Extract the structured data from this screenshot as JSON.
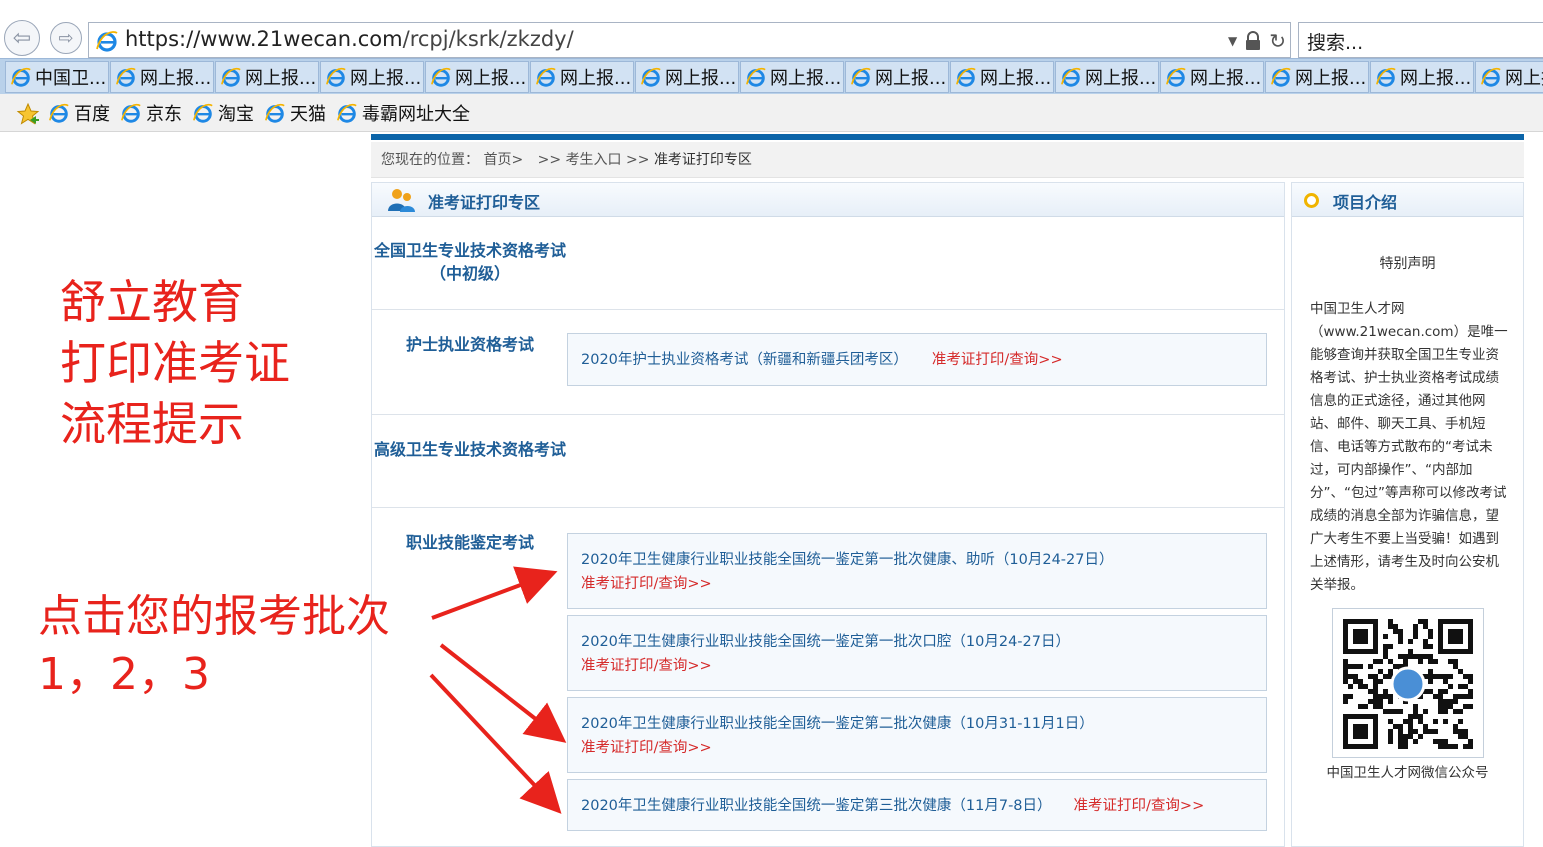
{
  "browser": {
    "url": "https://www.21wecan.com/rcpj/ksrk/zkzdy/",
    "url_host": "https://www.21wecan.com",
    "url_path": "/rcpj/ksrk/zkzdy/",
    "search_placeholder": "搜索...",
    "tabs": [
      "中国卫...",
      "网上报...",
      "网上报...",
      "网上报...",
      "网上报...",
      "网上报...",
      "网上报...",
      "网上报...",
      "网上报...",
      "网上报...",
      "网上报...",
      "网上报...",
      "网上报...",
      "网上报...",
      "网上报..."
    ],
    "favorites": [
      "百度",
      "京东",
      "淘宝",
      "天猫",
      "毒霸网址大全"
    ],
    "icons": [
      "back-arrow-icon",
      "forward-arrow-icon",
      "ie-logo-icon",
      "lock-icon",
      "refresh-icon",
      "dropdown-icon",
      "favorites-star-icon"
    ]
  },
  "breadcrumb": {
    "prefix": "您现在的位置：",
    "home": "首页>",
    "sep1": ">>",
    "level1": "考生入口",
    "sep2": ">>",
    "current": "准考证打印专区"
  },
  "main": {
    "title": "准考证打印专区",
    "sections": [
      {
        "label": "全国卫生专业技术资格考试（中初级）",
        "exams": []
      },
      {
        "label": "护士执业资格考试",
        "exams": [
          {
            "name": "2020年护士执业资格考试（新疆和新疆兵团考区）",
            "link": "准考证打印/查询>>"
          }
        ]
      },
      {
        "label": "高级卫生专业技术资格考试",
        "exams": []
      },
      {
        "label": "职业技能鉴定考试",
        "exams": [
          {
            "name": "2020年卫生健康行业职业技能全国统一鉴定第一批次健康、助听（10月24-27日）",
            "link": "准考证打印/查询>>"
          },
          {
            "name": "2020年卫生健康行业职业技能全国统一鉴定第一批次口腔（10月24-27日）",
            "link": "准考证打印/查询>>"
          },
          {
            "name": "2020年卫生健康行业职业技能全国统一鉴定第二批次健康（10月31-11月1日）",
            "link": "准考证打印/查询>>"
          },
          {
            "name": "2020年卫生健康行业职业技能全国统一鉴定第三批次健康（11月7-8日）",
            "link": "准考证打印/查询>>"
          }
        ]
      }
    ]
  },
  "side": {
    "title": "项目介绍",
    "subtitle": "特别声明",
    "notice": "中国卫生人才网（www.21wecan.com）是唯一能够查询并获取全国卫生专业资格考试、护士执业资格考试成绩信息的正式途径，通过其他网站、邮件、聊天工具、手机短信、电话等方式散布的“考试未过，可内部操作”、“内部加分”、“包过”等声称可以修改考试成绩的消息全部为诈骗信息，望广大考生不要上当受骗！如遇到上述情形，请考生及时向公安机关举报。",
    "qr_caption": "中国卫生人才网微信公众号"
  },
  "annotations": {
    "title_lines": [
      "舒立教育",
      "打印准考证",
      "流程提示"
    ],
    "click_lines": [
      "点击您的报考批次",
      "1，2，3"
    ],
    "color": "#e8231c"
  },
  "colors": {
    "brand_blue": "#0b64a8",
    "link_blue": "#1f5e97",
    "link_red": "#d52a2a"
  }
}
